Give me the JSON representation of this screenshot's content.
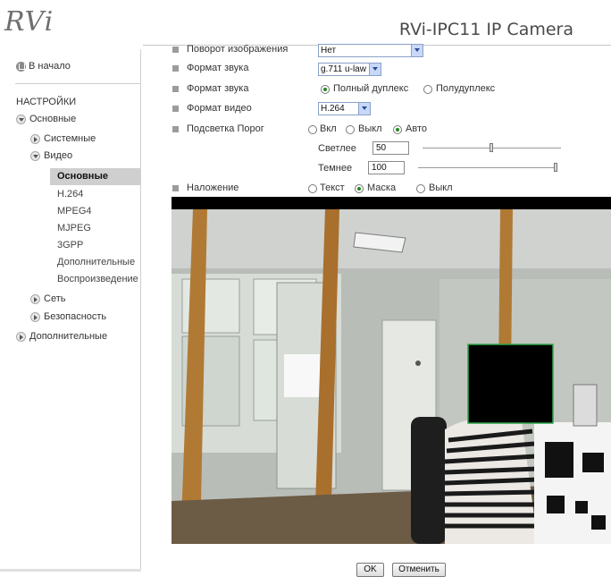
{
  "header": {
    "logo": "RVi",
    "title": "RVi-IPC11 IP Camera"
  },
  "sidebar": {
    "home": "В начало",
    "heading": "НАСТРОЙКИ",
    "tree": [
      {
        "label": "Основные"
      },
      {
        "label": "Системные"
      },
      {
        "label": "Видео"
      },
      {
        "label": "Сеть"
      },
      {
        "label": "Безопасность"
      },
      {
        "label": "Дополнительные"
      }
    ],
    "video_items": [
      "Основные",
      "H.264",
      "MPEG4",
      "MJPEG",
      "3GPP",
      "Дополнительные",
      "Воспроизведение"
    ]
  },
  "form": {
    "rotate": {
      "label": "Поворот изображения",
      "value": "Нет"
    },
    "audio_format": {
      "label": "Формат звука",
      "value": "g.711 u-law"
    },
    "audio_mode": {
      "label": "Формат звука",
      "options": [
        "Полный дуплекс",
        "Полудуплекс"
      ],
      "selected": "Полный дуплекс"
    },
    "video_format": {
      "label": "Формат видео",
      "value": "H.264"
    },
    "backlight": {
      "label": "Подсветка Порог",
      "options": [
        "Вкл",
        "Выкл",
        "Авто"
      ],
      "selected": "Авто"
    },
    "brighter": {
      "label": "Светлее",
      "value": "50",
      "level": 0.5
    },
    "darker": {
      "label": "Темнее",
      "value": "100",
      "level": 1.0
    },
    "overlay": {
      "label": "Наложение",
      "options": [
        "Текст",
        "Маска",
        "Выкл"
      ],
      "selected": "Маска"
    }
  },
  "actions": {
    "ok": "OK",
    "cancel": "Отменить"
  },
  "colors": {
    "mask_border": "#2ea84a",
    "radio_selected": "#228822"
  }
}
